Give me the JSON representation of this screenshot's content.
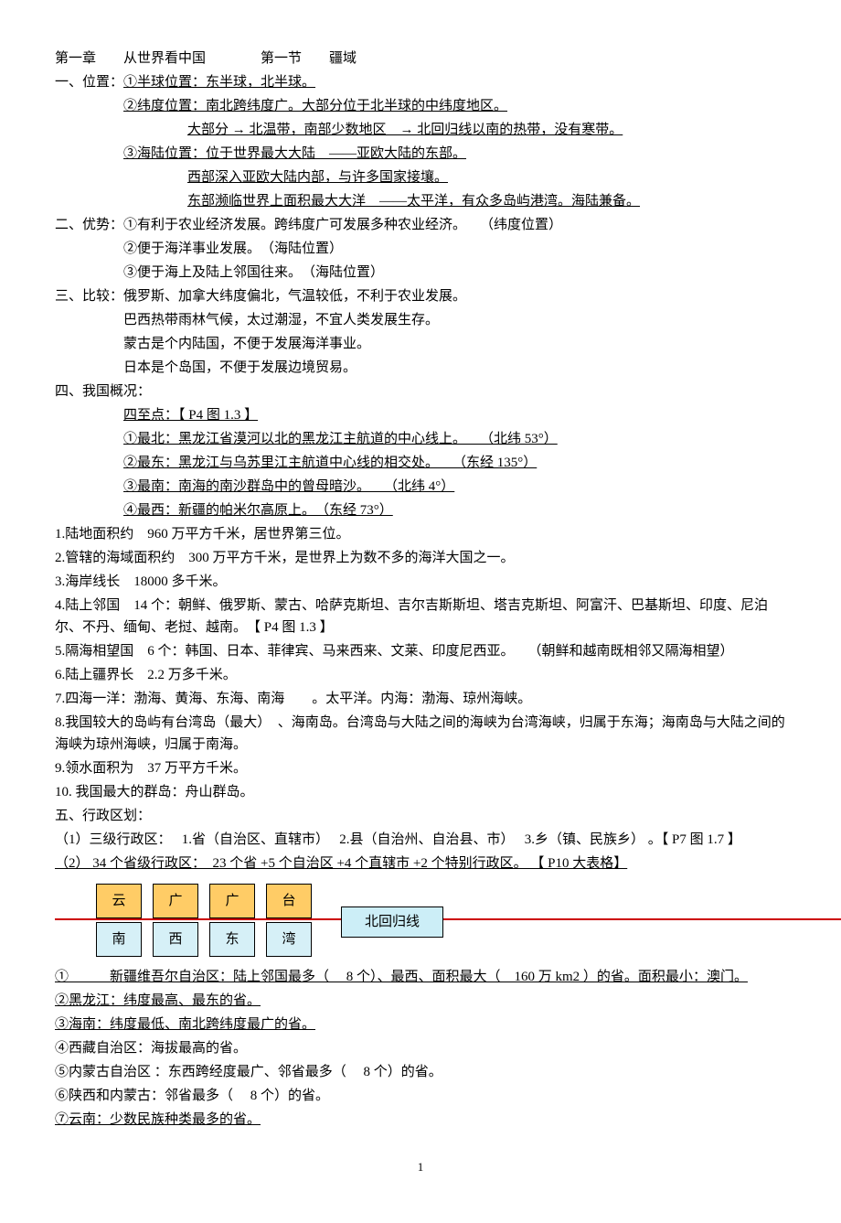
{
  "title": "第一章　　从世界看中国　　　　第一节　　疆域",
  "s1_head": "一、位置：",
  "s1_1": "①半球位置：东半球，北半球。",
  "s1_2": "②纬度位置：南北跨纬度广。大部分位于北半球的中纬度地区。",
  "s1_2b": "大部分 → 北温带，南部少数地区　→ 北回归线以南的热带，没有寒带。",
  "s1_3": "③海陆位置：位于世界最大大陆　——亚欧大陆的东部。",
  "s1_3b": "西部深入亚欧大陆内部，与许多国家接壤。",
  "s1_3c": "东部濒临世界上面积最大大洋　——太平洋，有众多岛屿港湾。海陆兼备。",
  "s2_head": "二、优势：",
  "s2_1": "①有利于农业经济发展。跨纬度广可发展多种农业经济。　　（纬度位置）",
  "s2_2": "②便于海洋事业发展。　（海陆位置）",
  "s2_3": "③便于海上及陆上邻国往来。　（海陆位置）",
  "s3_head": "三、比较：",
  "s3_1": "俄罗斯、加拿大纬度偏北，气温较低，不利于农业发展。",
  "s3_2": "巴西热带雨林气候，太过潮湿，不宜人类发展生存。",
  "s3_3": "蒙古是个内陆国，不便于发展海洋事业。",
  "s3_4": "日本是个岛国，不便于发展边境贸易。",
  "s4_head": "四、我国概况：",
  "s4_sub": "四至点：【 P4  图  1.3 】",
  "s4_1": "①最北：黑龙江省漠河以北的黑龙江主航道的中心线上。　　（北纬  53°）",
  "s4_2": "②最东：黑龙江与乌苏里江主航道中心线的相交处。　　（东经  135°）",
  "s4_3": "③最南：南海的南沙群岛中的曾母暗沙。　　（北纬  4°）",
  "s4_4": "④最西：新疆的帕米尔高原上。　（东经  73°）",
  "p1": "1.陆地面积约　960 万平方千米，居世界第三位。",
  "p2": "2.管辖的海域面积约　300 万平方千米，是世界上为数不多的海洋大国之一。",
  "p3": "3.海岸线长　18000 多千米。",
  "p4": "4.陆上邻国　14 个：朝鲜、俄罗斯、蒙古、哈萨克斯坦、吉尔吉斯斯坦、塔吉克斯坦、阿富汗、巴基斯坦、印度、尼泊尔、不丹、缅甸、老挝、越南。　【 P4  图  1.3 】",
  "p5": "5.隔海相望国　6 个：韩国、日本、菲律宾、马来西来、文莱、印度尼西亚。　　（朝鲜和越南既相邻又隔海相望）",
  "p6": "6.陆上疆界长　2.2 万多千米。",
  "p7": "7.四海一洋：渤海、黄海、东海、南海　　。太平洋。内海：渤海、琼州海峡。",
  "p8": "8.我国较大的岛屿有台湾岛（最大）　、海南岛。台湾岛与大陆之间的海峡为台湾海峡，归属于东海；海南岛与大陆之间的海峡为琼州海峡，归属于南海。",
  "p9": "9.领水面积为　37 万平方千米。",
  "p10": "10.  我国最大的群岛：舟山群岛。",
  "s5_head": "五、行政区划：",
  "s5_1": "（1）三级行政区：　 1.省（自治区、直辖市）　 2.县（自治州、自治县、市）　 3.乡（镇、民族乡） 。【 P7  图  1.7 】",
  "s5_2": "（2） 34 个省级行政区：　23 个省 +5 个自治区 +4 个直辖市 +2 个特别行政区。 【 P10  大表格】",
  "boxes": [
    {
      "top": "云",
      "bot": "南"
    },
    {
      "top": "广",
      "bot": "西"
    },
    {
      "top": "广",
      "bot": "东"
    },
    {
      "top": "台",
      "bot": "湾"
    }
  ],
  "tropic": "北回归线",
  "n1a": "①",
  "n1b": "　　　新疆维吾尔自治区：陆上邻国最多（　 8 个）、最西、面积最大（　160 万 km2 ）的省。面积最小：澳门。",
  "n2": "②黑龙江：纬度最高、最东的省。",
  "n3": "③海南：纬度最低、南北跨纬度最广的省。",
  "n4": "④西藏自治区：海拔最高的省。",
  "n5": "⑤内蒙古自治区 ：东西跨经度最广、邻省最多（　 8 个）的省。",
  "n6": "⑥陕西和内蒙古：邻省最多（　 8 个）的省。",
  "n7": "⑦云南：少数民族种类最多的省。",
  "pagenum": "1"
}
